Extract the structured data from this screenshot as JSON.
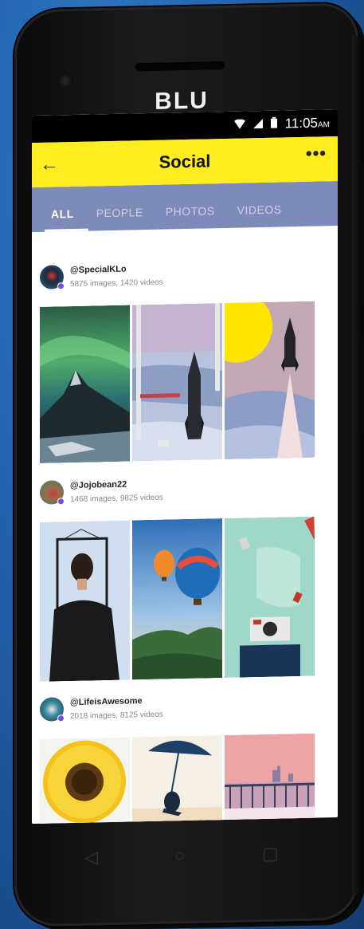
{
  "device": {
    "brand": "BLU"
  },
  "status_bar": {
    "time": "11:05",
    "ampm": "AM",
    "icons": [
      "wifi-icon",
      "signal-icon",
      "battery-icon"
    ]
  },
  "app_bar": {
    "title": "Social",
    "back_icon": "back-arrow-icon",
    "more_icon": "more-dots-icon"
  },
  "tabs": [
    {
      "label": "ALL",
      "active": true
    },
    {
      "label": "PEOPLE",
      "active": false
    },
    {
      "label": "PHOTOS",
      "active": false
    },
    {
      "label": "VIDEOS",
      "active": false
    }
  ],
  "posts": [
    {
      "handle": "@SpecialKLo",
      "counts": "5875 images,   1420 videos",
      "thumbs": [
        "aurora-mountain",
        "rocket-birch-landscape",
        "rocket-launch-sun"
      ]
    },
    {
      "handle": "@Jojobean22",
      "counts": "1468 images,   9825 videos",
      "thumbs": [
        "man-in-frame",
        "hot-air-balloons",
        "polaroid-camera"
      ]
    },
    {
      "handle": "@LifeisAwesome",
      "counts": "2018 images,   8125 videos",
      "thumbs": [
        "sunflower",
        "beach-umbrella",
        "pink-skyline"
      ]
    }
  ],
  "nav_bar": {
    "back": "◁",
    "home": "○",
    "recents": "▢"
  },
  "colors": {
    "app_bar": "#ffed1f",
    "tabs": "#7e8ab7",
    "accent": "#7a4fd8"
  }
}
